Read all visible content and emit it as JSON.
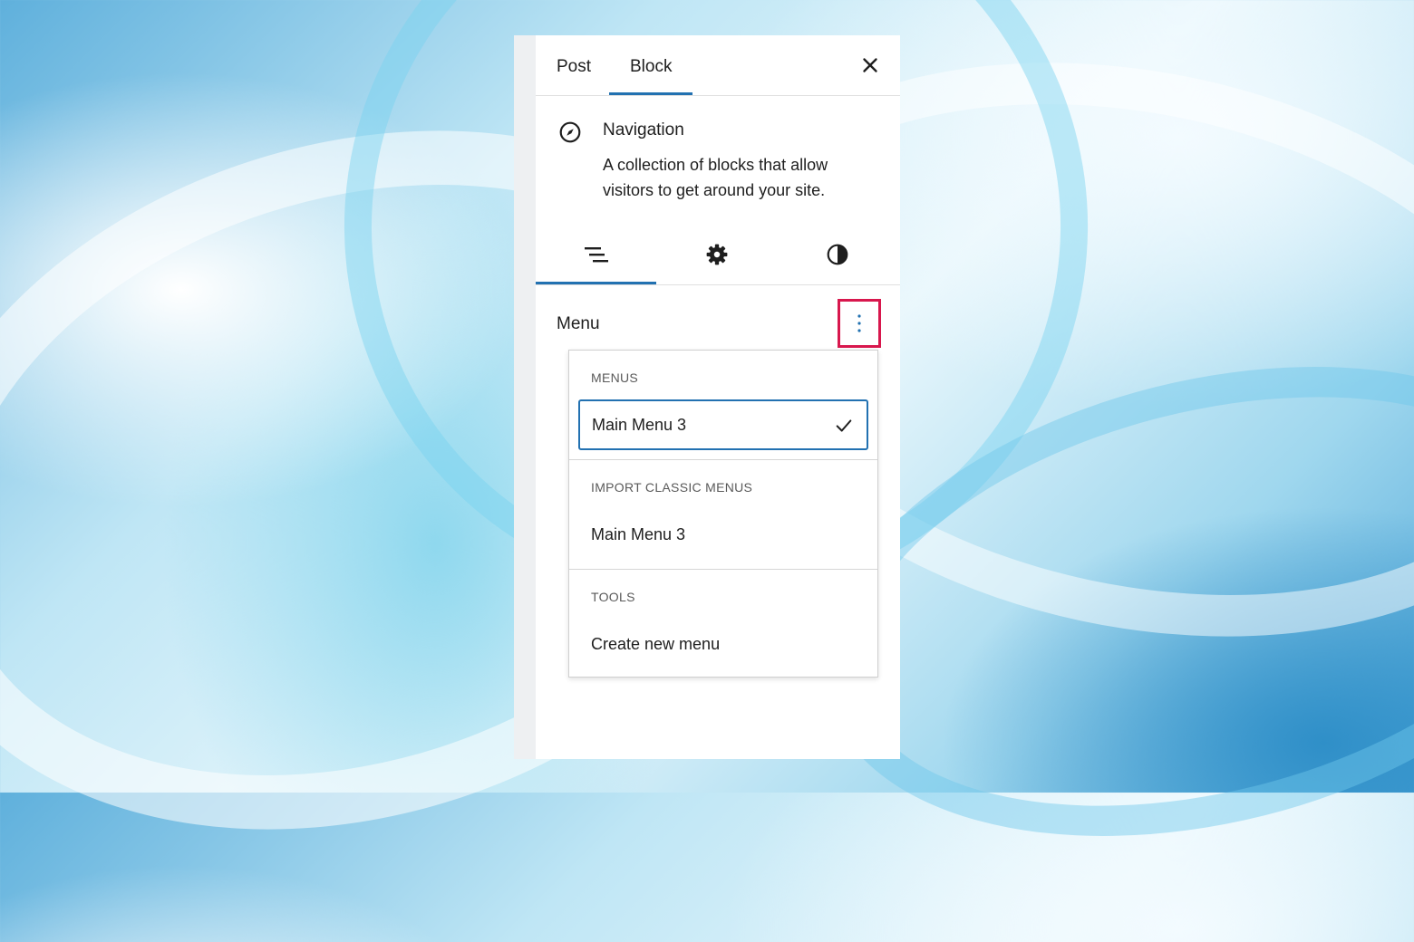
{
  "sidebar_tabs": {
    "post": "Post",
    "block": "Block"
  },
  "block_card": {
    "title": "Navigation",
    "description": "A collection of blocks that allow visitors to get around your site."
  },
  "icons": {
    "close": "close-icon",
    "block": "compass-icon",
    "tabs": [
      "list-view-icon",
      "gear-icon",
      "contrast-icon"
    ],
    "options": "vertical-ellipsis-icon",
    "selected": "checkmark-icon"
  },
  "menu_section": {
    "label": "Menu"
  },
  "dropdown": {
    "menus_title": "MENUS",
    "menus_items": [
      {
        "label": "Main Menu 3",
        "selected": true
      }
    ],
    "classic_title": "IMPORT CLASSIC MENUS",
    "classic_items": [
      {
        "label": "Main Menu 3"
      }
    ],
    "tools_title": "TOOLS",
    "tools_items": [
      {
        "label": "Create new menu"
      }
    ]
  },
  "colors": {
    "accent": "#2271b1",
    "highlight": "#d8174d"
  }
}
